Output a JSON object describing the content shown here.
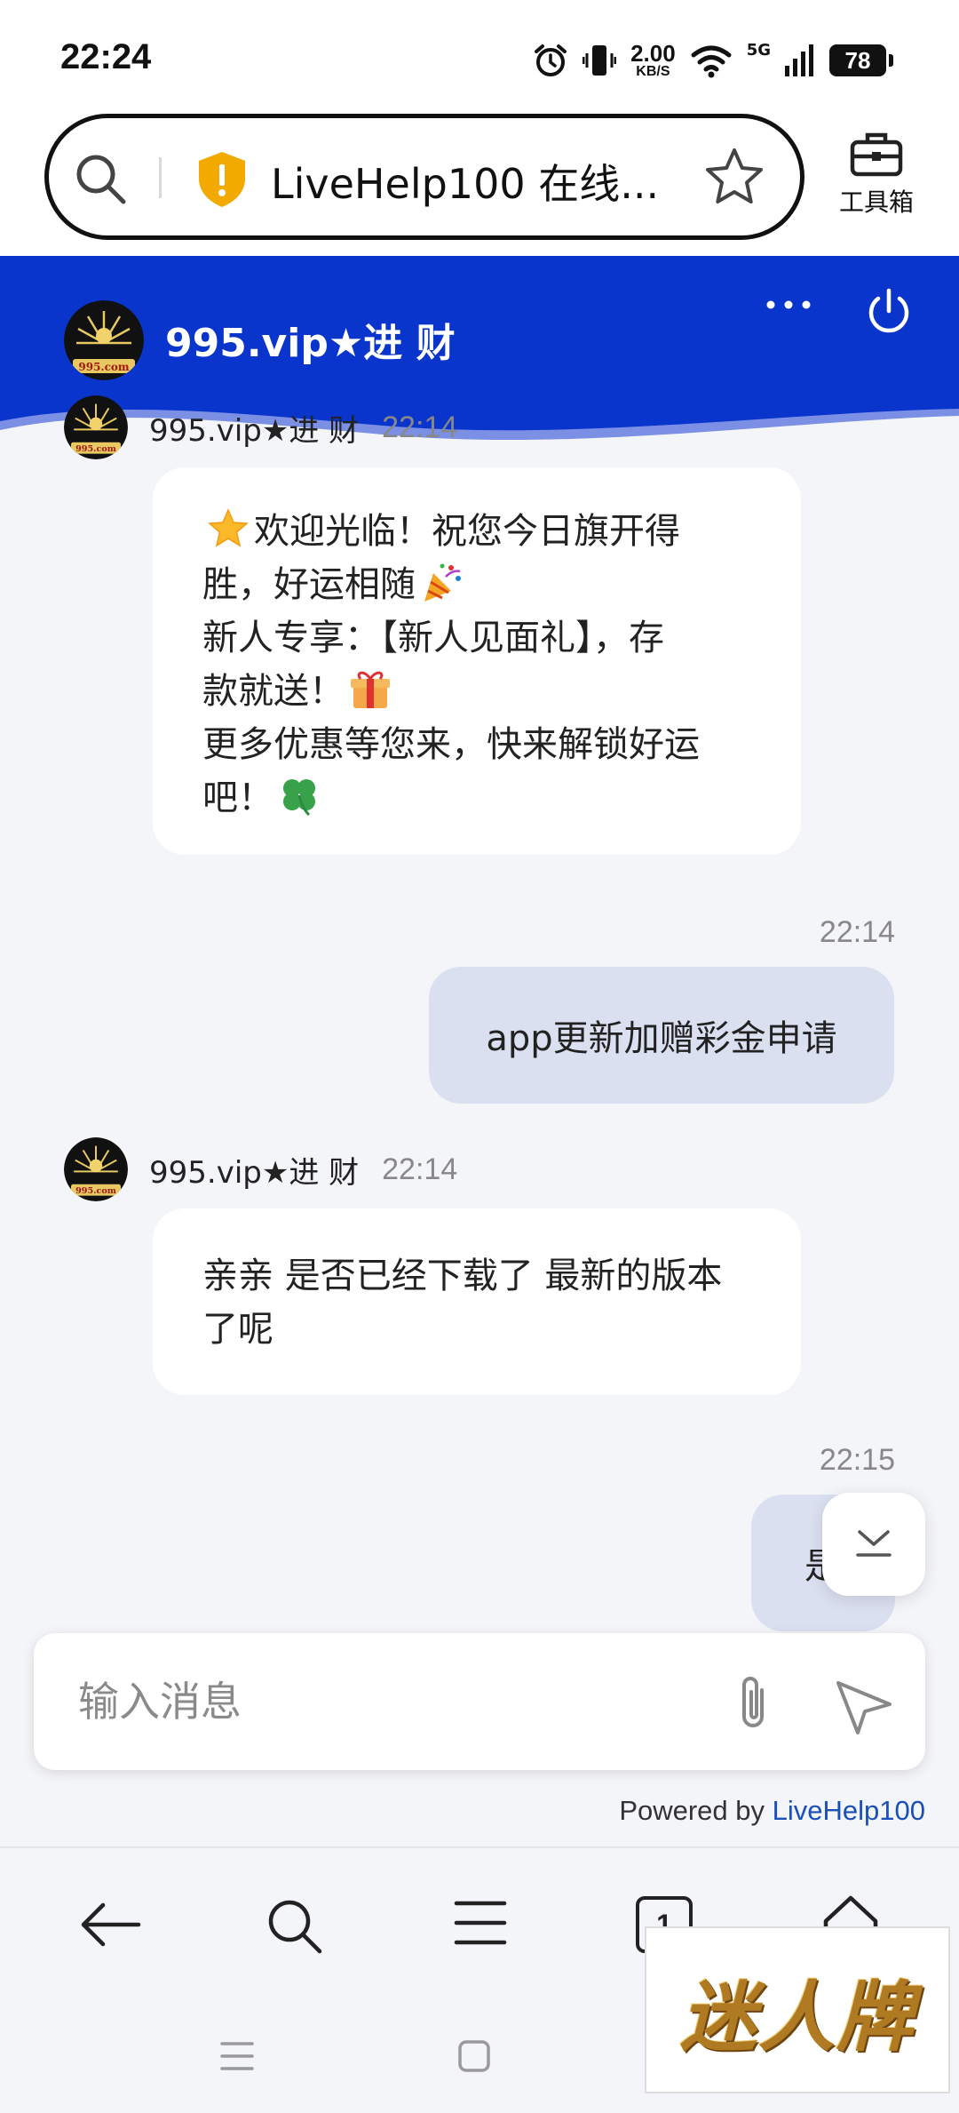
{
  "status_bar": {
    "time": "22:24",
    "net_speed": "2.00",
    "net_unit": "KB/S",
    "signal_label": "5G",
    "battery": "78"
  },
  "address_bar": {
    "url_title": "LiveHelp100 在线...",
    "toolbox_label": "工具箱"
  },
  "chat_header": {
    "title": "995.vip★进 财"
  },
  "messages": [
    {
      "sender": "995.vip★进 财",
      "time": "22:14",
      "lines": [
        "欢迎光临！祝您今日旗开得",
        "胜，好运相随",
        "新人专享：【新人见面礼】，存",
        "款就送！",
        "更多优惠等您来，快来解锁好运",
        "吧！"
      ]
    },
    {
      "time": "22:14",
      "text": "app更新加赠彩金申请"
    },
    {
      "sender": "995.vip★进 财",
      "time": "22:14",
      "lines": [
        "亲亲 是否已经下载了 最新的版本",
        "了呢"
      ]
    },
    {
      "time": "22:15",
      "text": "是"
    }
  ],
  "composer": {
    "placeholder": "输入消息"
  },
  "footer": {
    "powered_prefix": "Powered by ",
    "powered_link": "LiveHelp100"
  },
  "browser_nav": {
    "tab_count": "1"
  },
  "watermark": {
    "text": "迷人牌"
  },
  "colors": {
    "header_blue": "#0a35cc",
    "user_bubble": "#dbe0f1",
    "background": "#f4f5f8",
    "link": "#1a4fb8"
  }
}
